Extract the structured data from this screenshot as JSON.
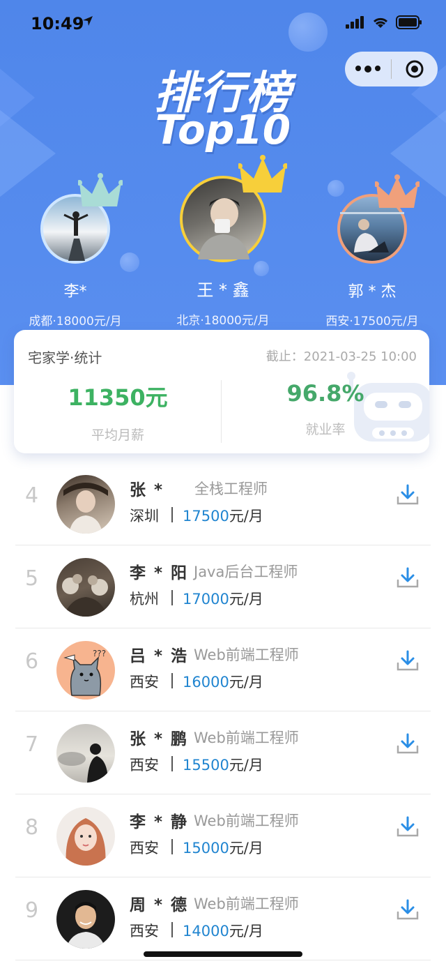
{
  "status_bar": {
    "time": "10:49"
  },
  "header": {
    "title": "排行榜",
    "subtitle": "Top10"
  },
  "podium": [
    {
      "name": "李*",
      "info": "成都·18000元/月",
      "rank": 2,
      "crown_color": "#a9dcd6"
    },
    {
      "name": "王 * 鑫",
      "info": "北京·18000元/月",
      "rank": 1,
      "crown_color": "#f7cf3a"
    },
    {
      "name": "郭 * 杰",
      "info": "西安·17500元/月",
      "rank": 3,
      "crown_color": "#f0a07b"
    }
  ],
  "stats": {
    "label": "宅家学·统计",
    "date": "截止：2021-03-25 10:00",
    "avg_salary": "11350元",
    "avg_salary_label": "平均月薪",
    "employment": "96.8%",
    "employment_label": "就业率"
  },
  "list": [
    {
      "rank": "4",
      "name": "张 *",
      "job": "全栈工程师",
      "city": "深圳",
      "salary": "17500",
      "unit": "元/月"
    },
    {
      "rank": "5",
      "name": "李 * 阳",
      "job": "Java后台工程师",
      "city": "杭州",
      "salary": "17000",
      "unit": "元/月"
    },
    {
      "rank": "6",
      "name": "吕 * 浩",
      "job": "Web前端工程师",
      "city": "西安",
      "salary": "16000",
      "unit": "元/月"
    },
    {
      "rank": "7",
      "name": "张 * 鹏",
      "job": "Web前端工程师",
      "city": "西安",
      "salary": "15500",
      "unit": "元/月"
    },
    {
      "rank": "8",
      "name": "李 * 静",
      "job": "Web前端工程师",
      "city": "西安",
      "salary": "15000",
      "unit": "元/月"
    },
    {
      "rank": "9",
      "name": "周 * 德",
      "job": "Web前端工程师",
      "city": "西安",
      "salary": "14000",
      "unit": "元/月"
    }
  ],
  "colors": {
    "header_blue": "#5a8ff0",
    "salary_blue": "#2185d0",
    "stat_green": "#3db262"
  }
}
